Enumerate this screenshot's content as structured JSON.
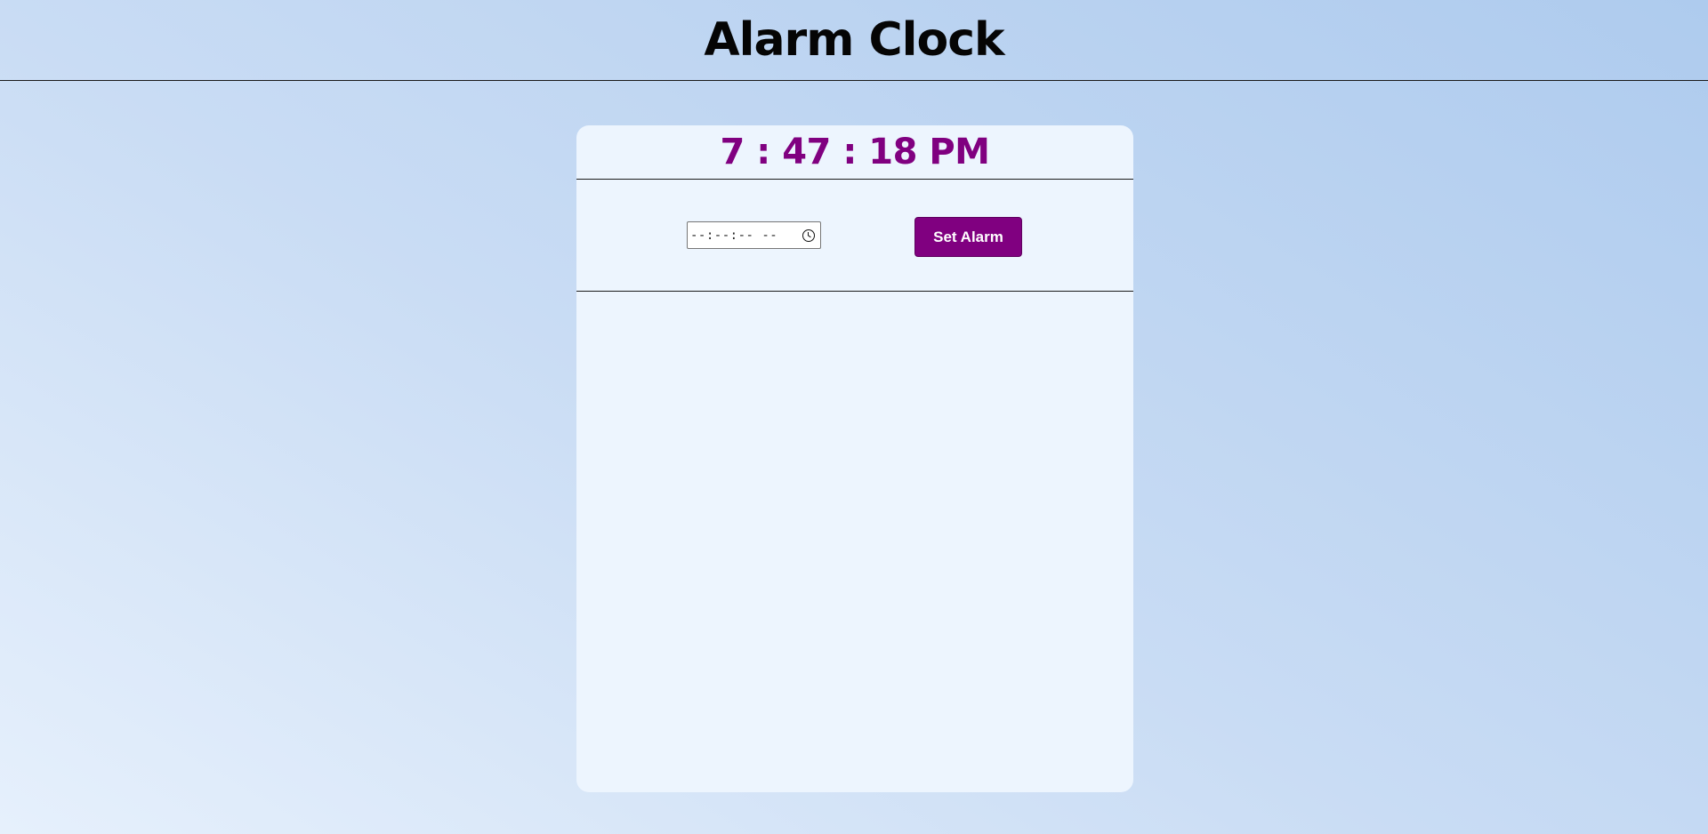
{
  "header": {
    "title": "Alarm Clock"
  },
  "clock": {
    "time": "7 : 47 : 18 PM"
  },
  "alarm_form": {
    "time_input_value": "--:--:-- --",
    "set_button_label": "Set Alarm"
  },
  "icons": {
    "time_picker": "clock-icon"
  },
  "colors": {
    "accent": "#800080",
    "card": "#edf5fe"
  },
  "alarms": []
}
